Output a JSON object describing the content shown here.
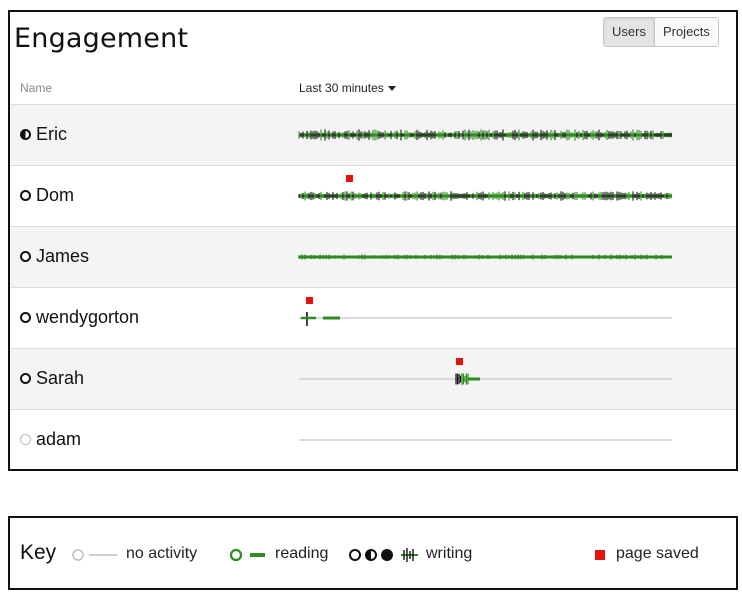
{
  "panel": {
    "title": "Engagement",
    "toggle": {
      "users": "Users",
      "projects": "Projects"
    },
    "columns": {
      "name": "Name",
      "time": "Last 30 minutes"
    }
  },
  "users": [
    {
      "name": "Eric",
      "status": "half",
      "activity": "writing-dense"
    },
    {
      "name": "Dom",
      "status": "empty",
      "activity": "writing-medium",
      "saved": true
    },
    {
      "name": "James",
      "status": "empty",
      "activity": "reading-full"
    },
    {
      "name": "wendygorton",
      "status": "empty",
      "activity": "early-burst",
      "saved": true
    },
    {
      "name": "Sarah",
      "status": "empty",
      "activity": "mid-burst",
      "saved": true
    },
    {
      "name": "adam",
      "status": "none",
      "activity": "none"
    }
  ],
  "key": {
    "title": "Key",
    "no_activity": "no activity",
    "reading": "reading",
    "writing": "writing",
    "page_saved": "page saved"
  },
  "colors": {
    "reading": "#2e8b1f",
    "writing": "#111111",
    "saved": "#e8120c",
    "idle": "#cfcfcf"
  }
}
